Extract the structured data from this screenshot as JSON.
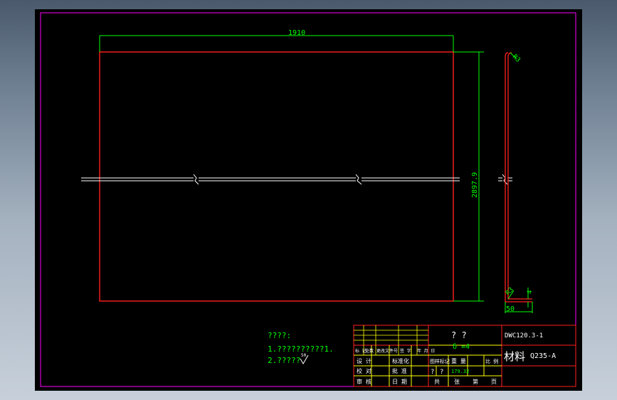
{
  "colors": {
    "background": "#000000",
    "frame": "#ff00ff",
    "outline": "#ff2020",
    "dimension": "#00ff00",
    "centerline": "#ffffff",
    "titleblock_grid": "#ffff00",
    "titleblock_line": "#ff2020",
    "text_white": "#ffffff"
  },
  "dimensions": {
    "width": "1910",
    "height": "2897.9",
    "bend_radius_top": "R3",
    "bend_radius_bottom": "R3",
    "flange": "50",
    "thickness": "4"
  },
  "notes": {
    "heading": "????:",
    "line1": "1.??????????1.",
    "line2": "2.?????",
    "roughness": "50"
  },
  "title_block": {
    "name": "?  ?",
    "thickness": "δ =4",
    "drawing_no": "DWC120.3-1",
    "material_label": "材料",
    "material": "Q235-A",
    "weight": "179.32",
    "rev_headers": [
      "标 记",
      "处数",
      "更改文件号",
      "签 字",
      "年 月 日"
    ],
    "rows": [
      {
        "label": "设 计",
        "col2": "标准化"
      },
      {
        "label": "校 对",
        "col2": "批 准"
      },
      {
        "label": "审 核",
        "col2": "日 期"
      }
    ],
    "stage_header": "图样标记",
    "weight_header": "重 量",
    "scale_header": "比 例",
    "stage_marks": [
      "?",
      "?"
    ],
    "footer": [
      "共",
      "张",
      "第",
      "页"
    ]
  }
}
